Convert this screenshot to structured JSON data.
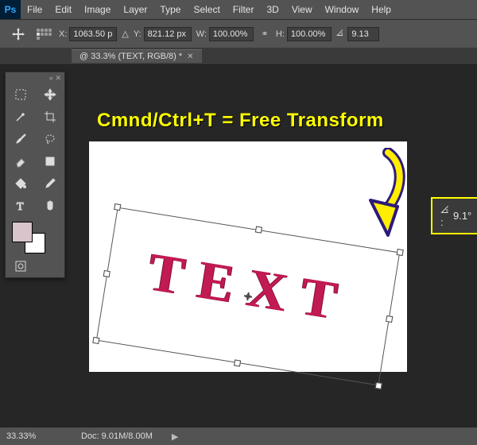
{
  "menu": {
    "items": [
      "File",
      "Edit",
      "Image",
      "Layer",
      "Type",
      "Select",
      "Filter",
      "3D",
      "View",
      "Window",
      "Help"
    ]
  },
  "options": {
    "x_label": "X:",
    "x_value": "1063.50 p",
    "y_label": "Y:",
    "y_value": "821.12 px",
    "w_label": "W:",
    "w_value": "100.00%",
    "h_label": "H:",
    "h_value": "100.00%",
    "angle_value": "9.13"
  },
  "doc_tab": {
    "title": "@ 33.3% (TEXT, RGB/8) *"
  },
  "annotation": {
    "line": "Cmnd/Ctrl+T = Free Transform"
  },
  "canvas": {
    "big_text": "TEXT"
  },
  "angle_badge": {
    "label": "9.1°"
  },
  "status": {
    "zoom": "33.33%",
    "doc": "Doc: 9.01M/8.00M"
  },
  "swatches": {
    "fg": "#d8c4ca",
    "bg": "#ffffff"
  },
  "icons": {
    "ps": "Ps"
  }
}
